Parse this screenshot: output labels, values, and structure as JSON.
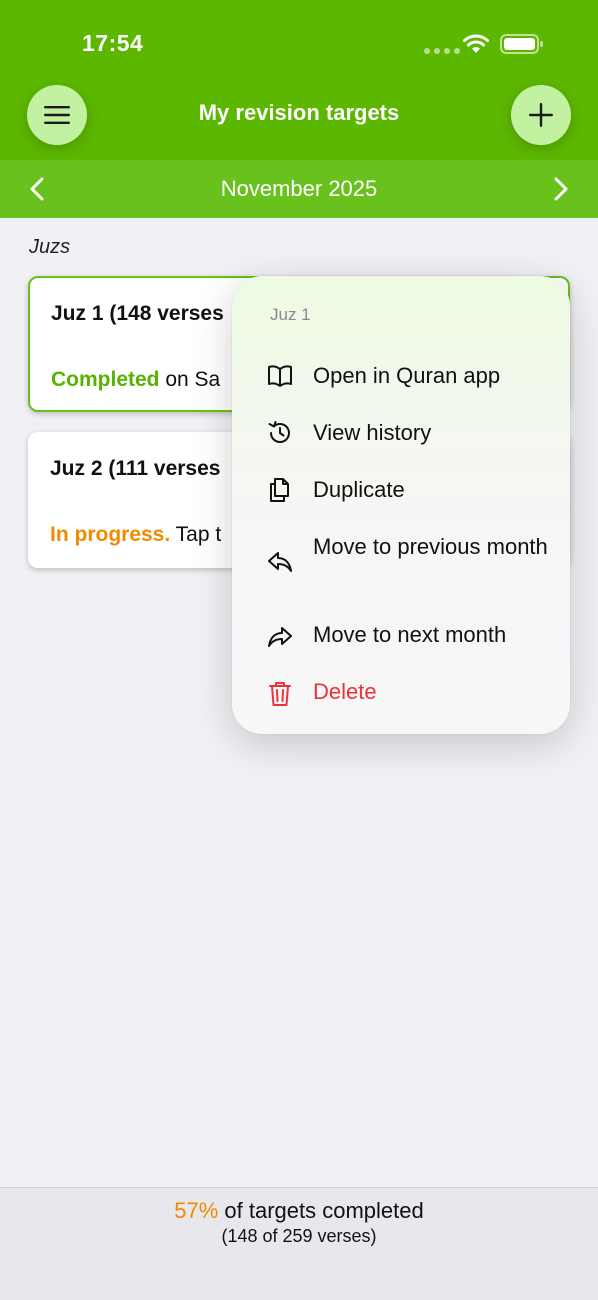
{
  "status_bar": {
    "time": "17:54"
  },
  "header": {
    "title": "My revision targets",
    "menu_icon": "hamburger-icon",
    "add_icon": "plus-icon"
  },
  "month_nav": {
    "label": "November 2025"
  },
  "section": {
    "label": "Juzs"
  },
  "cards": [
    {
      "title": "Juz 1 (148 verses",
      "status_highlight": "Completed",
      "status_rest": " on Sa",
      "status_color": "#58b300"
    },
    {
      "title": "Juz 2 (111 verses",
      "status_highlight": "In progress.",
      "status_rest": " Tap t",
      "status_color": "#f08a00"
    }
  ],
  "context_menu": {
    "header": "Juz 1",
    "items": [
      {
        "label": "Open in Quran app",
        "icon": "book-icon"
      },
      {
        "label": "View history",
        "icon": "history-icon"
      },
      {
        "label": "Duplicate",
        "icon": "duplicate-icon"
      },
      {
        "label": "Move to previous month",
        "icon": "reply-arrow-icon"
      },
      {
        "label": "Move to next month",
        "icon": "forward-arrow-icon"
      },
      {
        "label": "Delete",
        "icon": "trash-icon",
        "color": "#e8323c"
      }
    ]
  },
  "footer": {
    "percent": "57%",
    "summary_rest": " of targets completed",
    "detail": "(148 of 259 verses)"
  },
  "colors": {
    "header_green": "#5cb700",
    "month_bar_green": "#69c11d",
    "button_light_green": "#c2f2a1",
    "accent_orange": "#f08a00"
  }
}
